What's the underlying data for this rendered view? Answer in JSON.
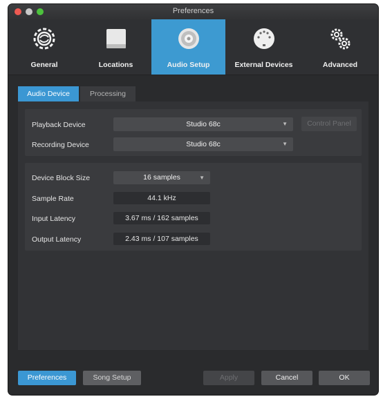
{
  "window": {
    "title": "Preferences"
  },
  "toolbar": {
    "items": [
      {
        "label": "General",
        "icon": "gear-sync-icon"
      },
      {
        "label": "Locations",
        "icon": "drive-icon"
      },
      {
        "label": "Audio Setup",
        "icon": "speaker-icon",
        "active": true
      },
      {
        "label": "External Devices",
        "icon": "midi-port-icon"
      },
      {
        "label": "Advanced",
        "icon": "gears-icon"
      }
    ],
    "active_color": "#3d9ad1"
  },
  "tabs": [
    {
      "label": "Audio Device",
      "active": true
    },
    {
      "label": "Processing",
      "active": false
    }
  ],
  "devices": {
    "playback_label": "Playback Device",
    "playback_value": "Studio 68c",
    "recording_label": "Recording Device",
    "recording_value": "Studio 68c",
    "control_panel_label": "Control Panel"
  },
  "settings": {
    "block_size_label": "Device Block Size",
    "block_size_value": "16 samples",
    "sample_rate_label": "Sample Rate",
    "sample_rate_value": "44.1 kHz",
    "input_latency_label": "Input Latency",
    "input_latency_value": "3.67 ms / 162 samples",
    "output_latency_label": "Output Latency",
    "output_latency_value": "2.43 ms / 107 samples"
  },
  "footer": {
    "preferences_label": "Preferences",
    "song_setup_label": "Song Setup",
    "apply_label": "Apply",
    "cancel_label": "Cancel",
    "ok_label": "OK"
  }
}
